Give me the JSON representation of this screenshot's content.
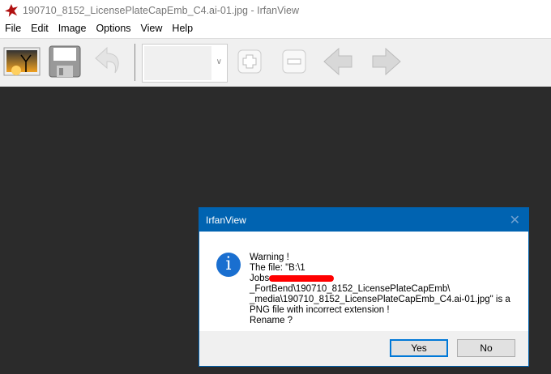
{
  "window": {
    "title": "190710_8152_LicensePlateCapEmb_C4.ai-01.jpg - IrfanView"
  },
  "menu": [
    "File",
    "Edit",
    "Image",
    "Options",
    "View",
    "Help"
  ],
  "toolbar": {
    "icons": [
      "open-icon",
      "save-icon",
      "undo-icon",
      "zoom-combo",
      "zoom-in-icon",
      "zoom-out-icon",
      "prev-icon",
      "next-icon"
    ]
  },
  "dialog": {
    "title": "IrfanView",
    "lines": [
      "Warning !",
      "The file: \"B:\\1",
      "Jobs",
      "_FortBend\\190710_8152_LicensePlateCapEmb\\",
      "_media\\190710_8152_LicensePlateCapEmb_C4.ai-01.jpg\" is a",
      "PNG file with incorrect extension !",
      "Rename ?"
    ],
    "yes": "Yes",
    "no": "No"
  }
}
